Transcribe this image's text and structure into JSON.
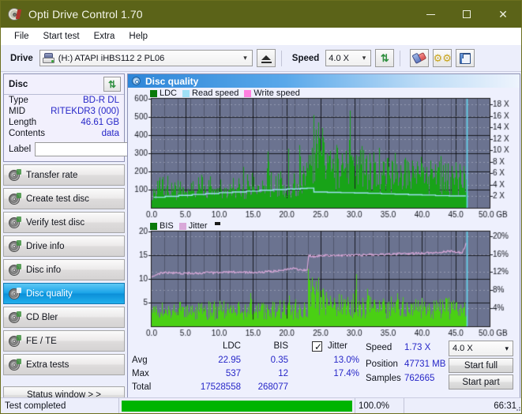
{
  "window": {
    "title": "Opti Drive Control 1.70",
    "icon": "disc-icon",
    "minimize": "—",
    "maximize": "□",
    "close": "✕"
  },
  "menu": {
    "items": [
      {
        "label": "File",
        "name": "menu-file"
      },
      {
        "label": "Start test",
        "name": "menu-start-test"
      },
      {
        "label": "Extra",
        "name": "menu-extra"
      },
      {
        "label": "Help",
        "name": "menu-help"
      }
    ]
  },
  "toolbar": {
    "drive_label": "Drive",
    "drive_value": "(H:)  ATAPI iHBS112  2 PL06",
    "eject_icon": "eject-icon",
    "speed_label": "Speed",
    "speed_value": "4.0 X",
    "refresh_icon": "refresh-icon",
    "eraser_icon": "eraser-icon",
    "tools_icon": "gear-icon",
    "save_icon": "save-floppy-icon",
    "chevron": "⌵"
  },
  "disc": {
    "title": "Disc",
    "refresh_icon": "refresh-icon",
    "rows": [
      {
        "key": "Type",
        "value": "BD-R DL"
      },
      {
        "key": "MID",
        "value": "RITEKDR3 (000)"
      },
      {
        "key": "Length",
        "value": "46.61 GB"
      },
      {
        "key": "Contents",
        "value": "data"
      }
    ],
    "label_key": "Label",
    "label_value": "",
    "label_placeholder": "",
    "label_button_icon": "cd-icon"
  },
  "nav": {
    "items": [
      {
        "label": "Transfer rate",
        "name": "sidebar-item-transfer-rate",
        "active": false
      },
      {
        "label": "Create test disc",
        "name": "sidebar-item-create-test-disc",
        "active": false
      },
      {
        "label": "Verify test disc",
        "name": "sidebar-item-verify-test-disc",
        "active": false
      },
      {
        "label": "Drive info",
        "name": "sidebar-item-drive-info",
        "active": false
      },
      {
        "label": "Disc info",
        "name": "sidebar-item-disc-info",
        "active": false
      },
      {
        "label": "Disc quality",
        "name": "sidebar-item-disc-quality",
        "active": true
      },
      {
        "label": "CD Bler",
        "name": "sidebar-item-cd-bler",
        "active": false
      },
      {
        "label": "FE / TE",
        "name": "sidebar-item-fe-te",
        "active": false
      },
      {
        "label": "Extra tests",
        "name": "sidebar-item-extra-tests",
        "active": false
      }
    ],
    "status_window": "Status window > >"
  },
  "panel": {
    "title": "Disc quality",
    "icon": "disc-quality-icon"
  },
  "stats": {
    "col_ldc": "LDC",
    "col_bis": "BIS",
    "jitter_label": "Jitter",
    "jitter_checked": true,
    "rows": [
      {
        "key": "Avg",
        "ldc": "22.95",
        "bis": "0.35",
        "jitter": "13.0%"
      },
      {
        "key": "Max",
        "ldc": "537",
        "bis": "12",
        "jitter": "17.4%"
      },
      {
        "key": "Total",
        "ldc": "17528558",
        "bis": "268077",
        "jitter": ""
      }
    ],
    "speed_label": "Speed",
    "speed_value": "1.73 X",
    "position_label": "Position",
    "position_value": "47731 MB",
    "samples_label": "Samples",
    "samples_value": "762665",
    "speed_select": "4.0 X",
    "chevron": "⌵",
    "start_full": "Start full",
    "start_part": "Start part"
  },
  "statusbar": {
    "text": "Test completed",
    "percent": "100.0%",
    "percent_value": 100,
    "time": "66:31"
  },
  "colors": {
    "title_bar": "#5b6318",
    "accent_blue": "#2e86d8",
    "plot_bg": "#6b7390",
    "ldc_green": "#18a318",
    "bis_green": "#3fc70a",
    "read_speed": "#9fe0f5",
    "write_speed": "#ff7fe0",
    "jitter_pink": "#d9a8d9",
    "value_blue": "#2626c8",
    "progress_green": "#00b400"
  },
  "chart_data": [
    {
      "type": "area",
      "name": "ldc-chart",
      "title": "",
      "xlabel": "GB",
      "ylabel": "",
      "xlim": [
        0,
        50
      ],
      "ylim": [
        0,
        600
      ],
      "y2lim": [
        0,
        18
      ],
      "y2label": "X",
      "grid": true,
      "legend_position": "top-left",
      "legend": [
        {
          "label": "LDC",
          "color": "#0a7a0a"
        },
        {
          "label": "Read speed",
          "color": "#9fe0f5"
        },
        {
          "label": "Write speed",
          "color": "#ff7fe0"
        }
      ],
      "xticks": [
        "0.0",
        "5.0",
        "10.0",
        "15.0",
        "20.0",
        "25.0",
        "30.0",
        "35.0",
        "40.0",
        "45.0",
        "50.0 GB"
      ],
      "yticks": [
        100,
        200,
        300,
        400,
        500,
        600
      ],
      "y2ticks": [
        "2 X",
        "4 X",
        "6 X",
        "8 X",
        "10 X",
        "12 X",
        "14 X",
        "16 X",
        "18 X"
      ],
      "scan_end_gb": 46.6,
      "cursor_gb": 46.6,
      "series": [
        {
          "name": "LDC",
          "color": "#18a318",
          "kind": "bars",
          "baseline_x": [
            0,
            5,
            10,
            15,
            20,
            23,
            25,
            27,
            30,
            33,
            36,
            40,
            43,
            46.6
          ],
          "baseline_y": [
            75,
            78,
            82,
            88,
            95,
            105,
            210,
            175,
            150,
            140,
            135,
            130,
            125,
            120
          ],
          "spike_x": [
            1.0,
            2.2,
            3.4,
            4.6,
            6.1,
            7.4,
            8.8,
            10.2,
            11.6,
            12.9,
            13.6,
            14.2,
            15.1,
            16.4,
            17.2,
            18.3,
            19.1,
            20.2,
            21.0,
            21.8,
            22.4,
            22.9,
            23.3,
            23.7,
            24.0,
            24.3,
            24.6,
            24.9,
            25.2,
            25.5,
            25.9,
            26.3,
            26.8,
            27.4,
            28.1,
            28.7,
            29.3,
            29.8,
            30.2,
            30.6,
            31.1,
            31.7,
            32.3,
            33.0,
            33.6,
            34.2,
            34.9,
            35.5,
            36.2,
            36.8,
            37.4,
            38.0,
            38.7,
            39.3,
            40.0,
            40.6,
            41.2,
            41.9,
            42.5,
            43.1,
            43.8,
            44.4,
            45.0,
            45.6,
            46.2
          ],
          "spike_y": [
            150,
            120,
            140,
            115,
            125,
            135,
            120,
            155,
            130,
            160,
            225,
            140,
            170,
            150,
            310,
            175,
            200,
            325,
            190,
            345,
            230,
            250,
            290,
            330,
            510,
            430,
            470,
            380,
            440,
            360,
            300,
            285,
            270,
            330,
            300,
            315,
            535,
            280,
            290,
            260,
            340,
            270,
            300,
            245,
            330,
            255,
            275,
            260,
            240,
            235,
            265,
            250,
            230,
            255,
            245,
            225,
            260,
            240,
            255,
            235,
            245,
            230,
            250,
            240,
            230
          ]
        },
        {
          "name": "Read speed",
          "color": "#9fe0f5",
          "kind": "step-line",
          "x": [
            0.3,
            2,
            4,
            6,
            8,
            10,
            12,
            14,
            16,
            18,
            20,
            22,
            23,
            24,
            26,
            28,
            30,
            32,
            34,
            36,
            38,
            40,
            42,
            44,
            46.4
          ],
          "y_x_units": [
            1.75,
            1.9,
            2.05,
            2.2,
            2.35,
            2.5,
            2.6,
            2.75,
            2.9,
            3.0,
            3.1,
            3.2,
            3.25,
            2.6,
            2.55,
            2.5,
            2.45,
            2.4,
            2.3,
            2.25,
            2.15,
            2.1,
            2.0,
            1.95,
            1.85
          ]
        }
      ]
    },
    {
      "type": "area",
      "name": "bis-jitter-chart",
      "title": "",
      "xlabel": "GB",
      "ylabel": "",
      "xlim": [
        0,
        50
      ],
      "ylim": [
        0,
        20
      ],
      "y2lim": [
        0,
        20
      ],
      "y2label": "%",
      "grid": true,
      "legend_position": "top-left",
      "legend": [
        {
          "label": "BIS",
          "color": "#0a7a0a"
        },
        {
          "label": "Jitter",
          "color": "#d9a8d9"
        }
      ],
      "xticks": [
        "0.0",
        "5.0",
        "10.0",
        "15.0",
        "20.0",
        "25.0",
        "30.0",
        "35.0",
        "40.0",
        "45.0",
        "50.0 GB"
      ],
      "yticks": [
        5,
        10,
        15,
        20
      ],
      "y2ticks": [
        "4%",
        "8%",
        "12%",
        "16%",
        "20%"
      ],
      "scan_end_gb": 46.6,
      "cursor_gb": 46.6,
      "series": [
        {
          "name": "BIS",
          "color": "#4ad014",
          "kind": "bars",
          "baseline_x": [
            0,
            5,
            10,
            15,
            20,
            23,
            24,
            26,
            30,
            35,
            40,
            46.6
          ],
          "baseline_y": [
            2.4,
            2.3,
            2.4,
            2.5,
            2.5,
            2.6,
            4.2,
            3.6,
            3.0,
            2.8,
            2.7,
            2.6
          ],
          "spike_x": [
            0.6,
            1.5,
            2.4,
            3.3,
            4.1,
            5.0,
            6.0,
            6.9,
            7.8,
            8.6,
            9.5,
            10.3,
            11.2,
            12.0,
            12.9,
            13.8,
            14.6,
            15.4,
            16.2,
            17.0,
            17.9,
            18.7,
            19.5,
            20.3,
            21.1,
            21.9,
            22.6,
            23.1,
            23.4,
            23.7,
            24.0,
            24.3,
            24.6,
            24.9,
            25.3,
            25.8,
            26.4,
            27.0,
            27.7,
            28.4,
            29.0,
            29.6,
            30.2,
            30.6,
            31.2,
            31.9,
            32.4,
            33.0,
            33.7,
            34.4,
            35.0,
            35.7,
            36.3,
            37.0,
            37.7,
            38.3,
            39.0,
            39.7,
            40.3,
            41.0,
            41.7,
            42.3,
            43.0,
            43.7,
            44.3,
            45.0,
            45.7,
            46.3
          ],
          "spike_y": [
            4.3,
            5.0,
            4.3,
            4.6,
            5.1,
            4.2,
            4.4,
            4.9,
            4.3,
            5.0,
            4.2,
            4.5,
            4.8,
            4.4,
            5.2,
            4.6,
            7.0,
            4.4,
            4.9,
            4.5,
            5.2,
            4.4,
            5.4,
            6.5,
            4.8,
            4.6,
            5.0,
            12.1,
            9.7,
            10.3,
            8.2,
            9.5,
            10.3,
            7.5,
            8.0,
            7.2,
            6.4,
            6.0,
            6.8,
            5.8,
            6.2,
            5.6,
            11.0,
            5.4,
            6.0,
            7.9,
            5.2,
            5.6,
            5.0,
            5.4,
            5.2,
            5.0,
            7.0,
            5.2,
            5.0,
            4.8,
            5.0,
            4.6,
            5.2,
            4.8,
            5.4,
            5.0,
            5.6,
            4.8,
            5.2,
            5.0,
            4.6,
            5.0
          ]
        },
        {
          "name": "Jitter",
          "color": "#d9a8d9",
          "kind": "line",
          "x": [
            0.2,
            1,
            2,
            3,
            4,
            5,
            6,
            7,
            8,
            9,
            10,
            11,
            12,
            13,
            14,
            15,
            16,
            17,
            18,
            19,
            20,
            20.7,
            21.4,
            22.0,
            22.6,
            23.0,
            23.2,
            24,
            25,
            26,
            27,
            28,
            29,
            30,
            31,
            32,
            33,
            34,
            35,
            36,
            37,
            38,
            39,
            40,
            41,
            42,
            43,
            44,
            45,
            46,
            46.5
          ],
          "y": [
            10.4,
            11.1,
            11.4,
            11.3,
            11.2,
            11.2,
            11.2,
            11.2,
            11.3,
            11.3,
            11.3,
            11.4,
            11.4,
            11.4,
            11.4,
            11.3,
            11.4,
            11.5,
            11.6,
            11.8,
            12.0,
            12.2,
            12.1,
            12.0,
            11.8,
            11.6,
            14.9,
            14.7,
            14.9,
            15.0,
            15.0,
            14.9,
            15.0,
            15.0,
            15.0,
            15.1,
            15.1,
            15.1,
            15.2,
            15.2,
            15.3,
            15.3,
            15.4,
            15.4,
            15.5,
            15.6,
            15.7,
            15.8,
            15.7,
            15.5,
            17.4
          ]
        }
      ]
    }
  ]
}
